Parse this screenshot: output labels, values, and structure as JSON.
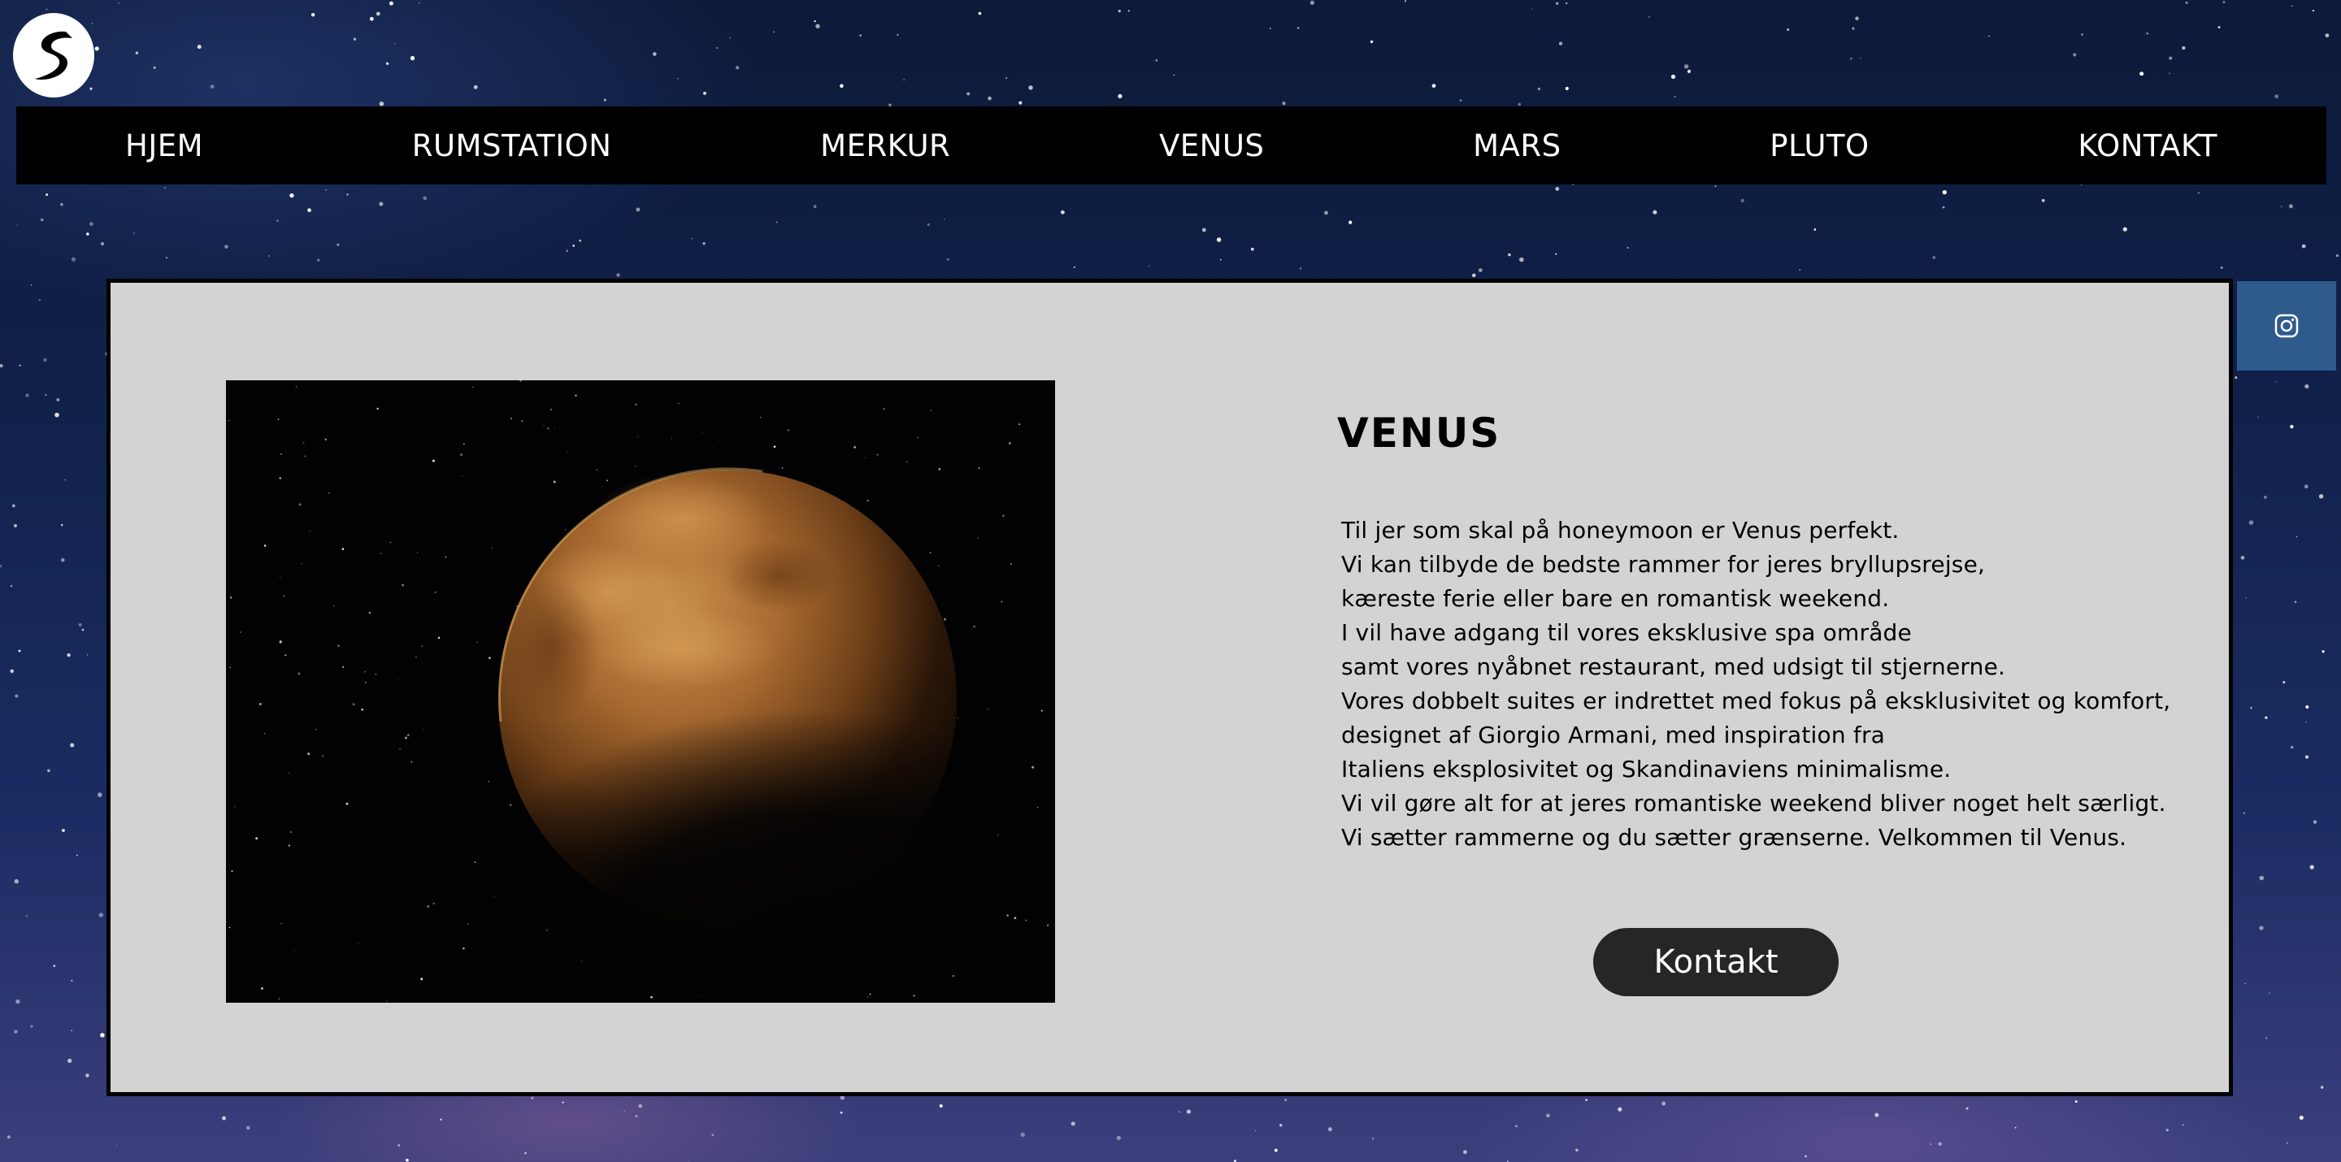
{
  "logo": {
    "letter": "S",
    "icon": "logo-s-icon"
  },
  "nav": {
    "items": [
      {
        "label": "HJEM"
      },
      {
        "label": "RUMSTATION"
      },
      {
        "label": "MERKUR"
      },
      {
        "label": "VENUS"
      },
      {
        "label": "MARS"
      },
      {
        "label": "PLUTO"
      },
      {
        "label": "KONTAKT"
      }
    ]
  },
  "main": {
    "title": "VENUS",
    "image": {
      "icon": "venus-planet-image"
    },
    "lines": [
      "Til jer som skal på honeymoon er Venus perfekt.",
      "Vi kan tilbyde de bedste rammer for jeres bryllupsrejse,",
      "kæreste ferie eller bare en romantisk weekend.",
      "I vil have adgang til vores eksklusive spa område",
      "samt vores nyåbnet restaurant, med udsigt til stjernerne.",
      "Vores dobbelt suites er indrettet med fokus på eksklusivitet og komfort,",
      "designet af Giorgio Armani, med inspiration fra",
      "Italiens eksplosivitet og Skandinaviens minimalisme.",
      "Vi vil gøre alt for at jeres romantiske weekend bliver noget helt særligt.",
      "Vi sætter rammerne og du sætter grænserne. Velkommen til Venus."
    ],
    "button_label": "Kontakt"
  },
  "social": {
    "icon": "instagram-icon"
  },
  "colors": {
    "nav_bg": "#000000",
    "panel_bg": "#d3d3d3",
    "button_bg": "#262626",
    "social_bg": "#2f5b8c"
  }
}
